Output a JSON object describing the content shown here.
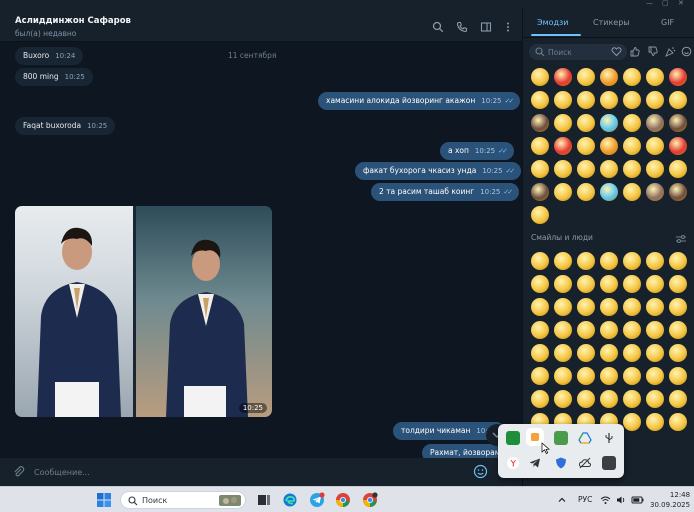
{
  "chat": {
    "name": "Аслиддинжон Сафаров",
    "status": "был(а) недавно",
    "date_separator": "11 сентября",
    "messages": [
      {
        "dir": "in",
        "text": "Buxoro",
        "time": "10:24"
      },
      {
        "dir": "in",
        "text": "800 ming",
        "time": "10:25"
      },
      {
        "dir": "out",
        "text": "хамасини алокида йозворинг акажон",
        "time": "10:25"
      },
      {
        "dir": "in",
        "text": "Faqat buxoroda",
        "time": "10:25"
      },
      {
        "dir": "out",
        "text": "а хоп",
        "time": "10:25"
      },
      {
        "dir": "out",
        "text": "факат бухорога чкасиз унда",
        "time": "10:25"
      },
      {
        "dir": "out",
        "text": "2 та расим ташаб коинг",
        "time": "10:25"
      },
      {
        "dir": "out",
        "text": "толдири чикаман",
        "time": "10:25"
      },
      {
        "dir": "out",
        "text": "Рахмат, йозворама",
        "time": ""
      }
    ],
    "photo_time": "10:25",
    "composer_placeholder": "Сообщение..."
  },
  "emoji_panel": {
    "tabs": [
      "Эмодзи",
      "Стикеры",
      "GIF"
    ],
    "active_tab": "Эмодзи",
    "search_placeholder": "Поиск",
    "section_title": "Смайлы и люди"
  },
  "taskbar": {
    "search_placeholder": "Поиск",
    "language": "РУС",
    "time": "12:48",
    "date": "30.09.2025"
  },
  "colors": {
    "background": "#0e1621",
    "panel": "#17212b",
    "incoming": "#182533",
    "outgoing": "#2b5278",
    "accent": "#6ec2f7"
  }
}
